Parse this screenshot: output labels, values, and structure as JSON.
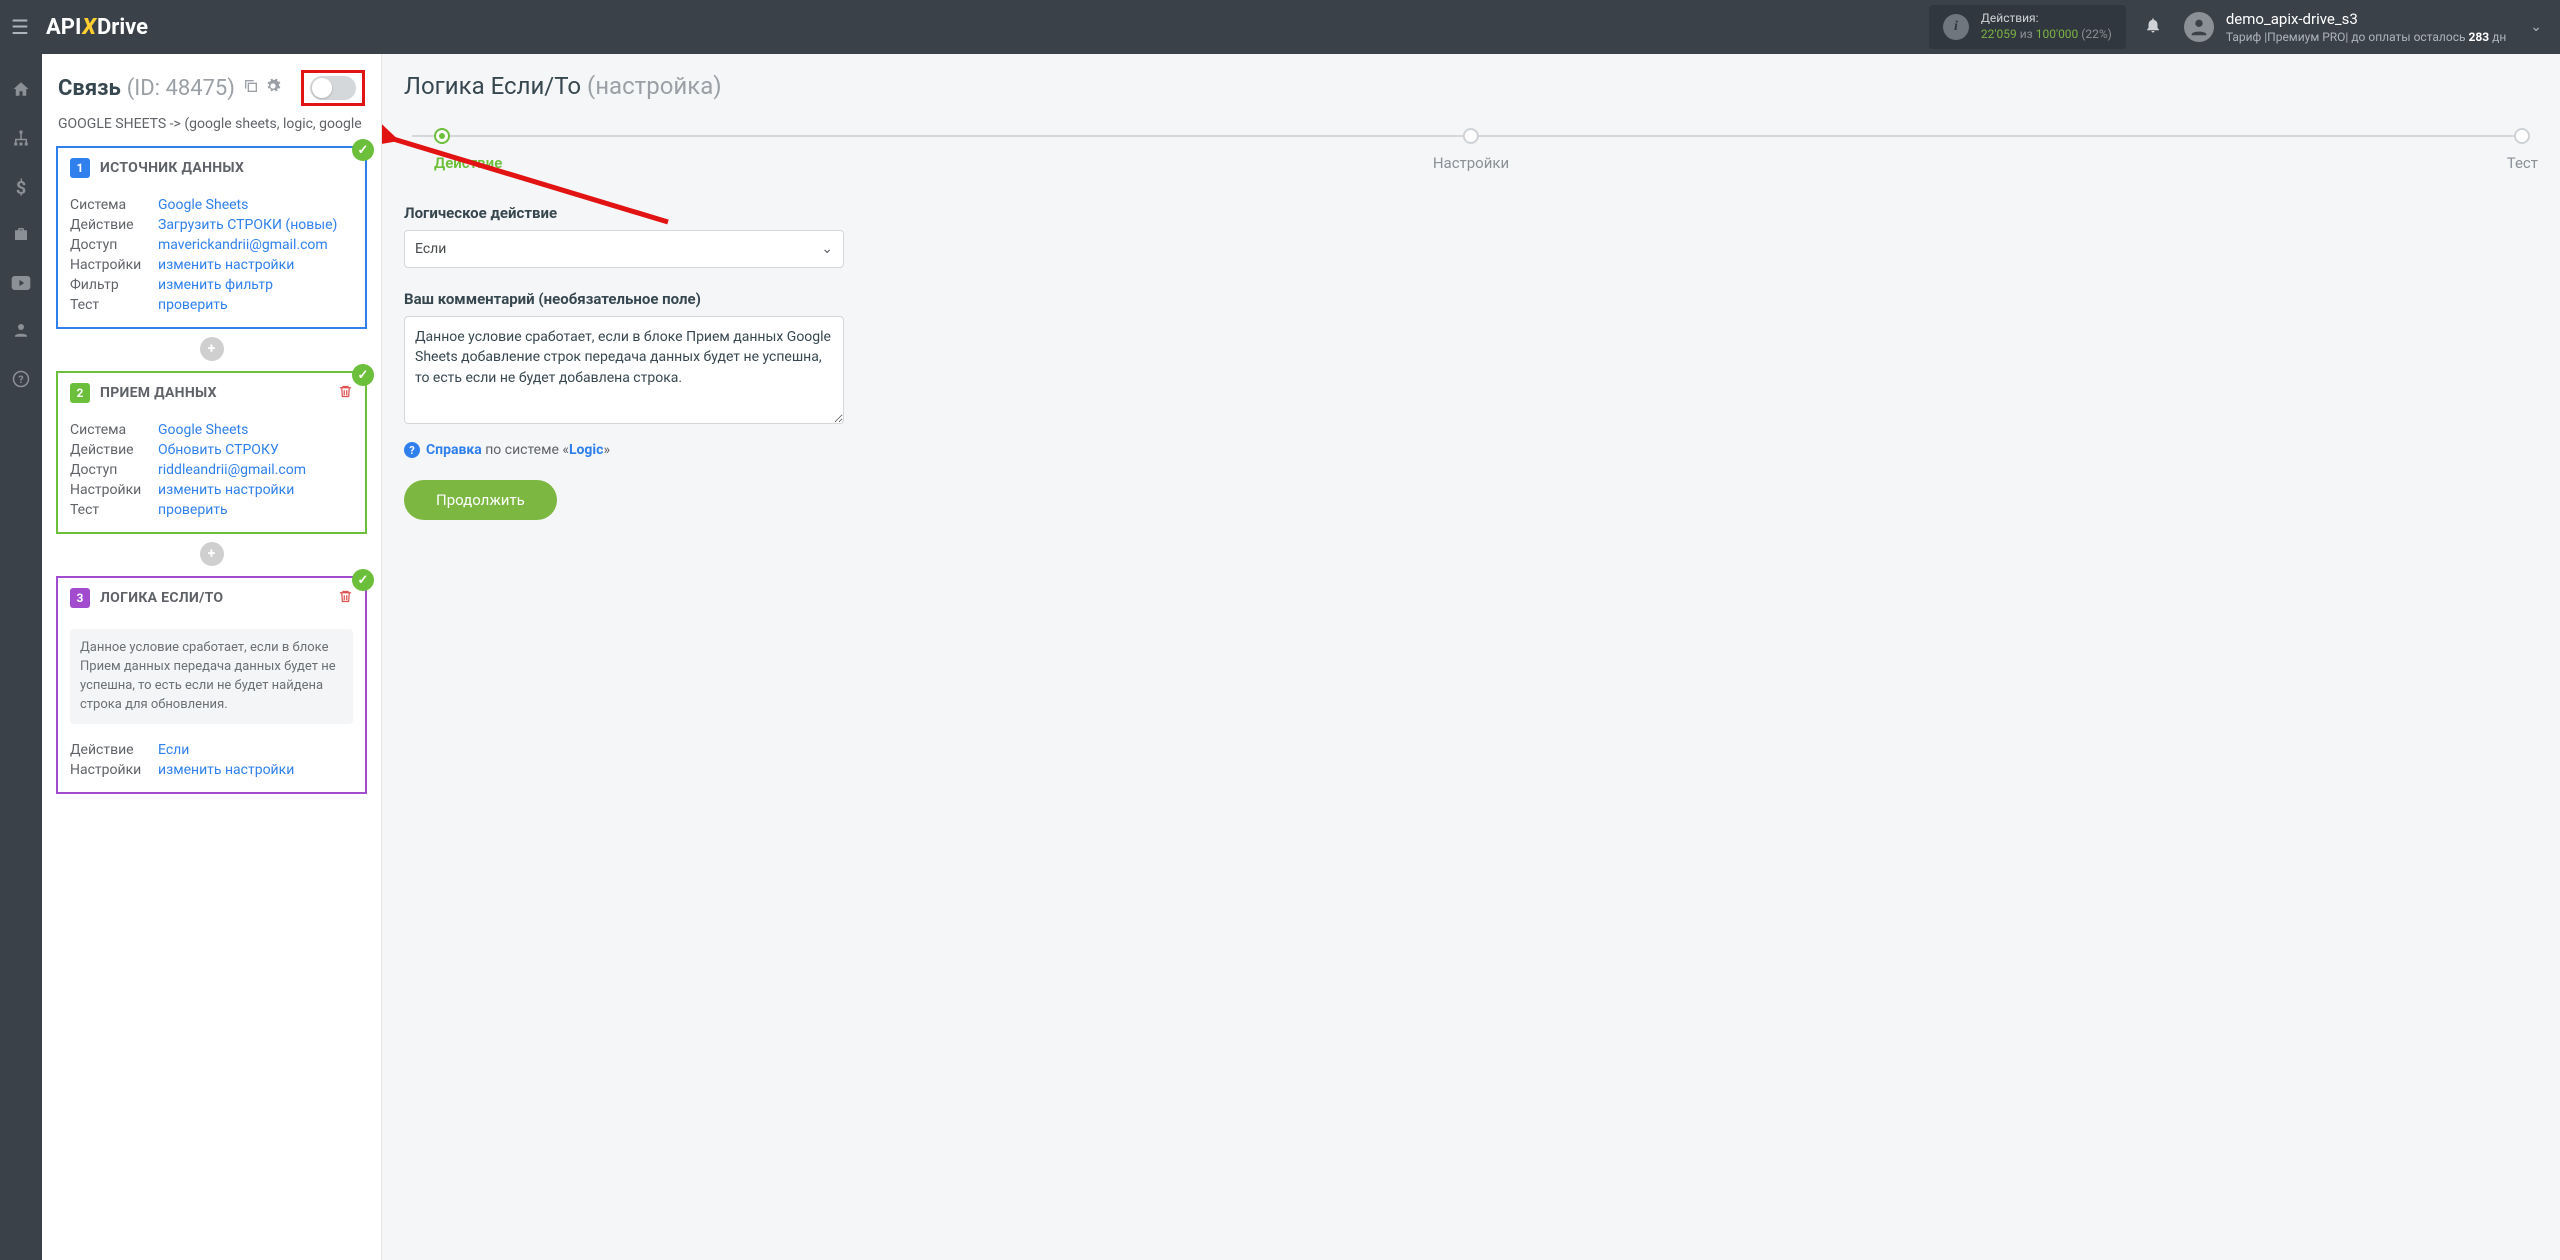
{
  "topbar": {
    "logo_pre": "API",
    "logo_x": "X",
    "logo_post": "Drive",
    "actions_label": "Действия:",
    "actions_used": "22'059",
    "actions_of": "из",
    "actions_total": "100'000",
    "actions_pct": "(22%)",
    "username": "demo_apix-drive_s3",
    "tariff_line_pre": "Тариф |Премиум PRO| до оплаты осталось ",
    "tariff_days": "283",
    "tariff_days_suffix": " дн"
  },
  "sidebar": {
    "title": "Связь",
    "id": "(ID: 48475)",
    "subtitle": "GOOGLE SHEETS -> (google sheets, logic, google",
    "card1": {
      "num": "1",
      "title": "ИСТОЧНИК ДАННЫХ",
      "rows": {
        "system_k": "Система",
        "system_v": "Google Sheets",
        "action_k": "Действие",
        "action_v": "Загрузить СТРОКИ (новые)",
        "access_k": "Доступ",
        "access_v": "maverickandrii@gmail.com",
        "settings_k": "Настройки",
        "settings_v": "изменить настройки",
        "filter_k": "Фильтр",
        "filter_v": "изменить фильтр",
        "test_k": "Тест",
        "test_v": "проверить"
      }
    },
    "card2": {
      "num": "2",
      "title": "ПРИЕМ ДАННЫХ",
      "rows": {
        "system_k": "Система",
        "system_v": "Google Sheets",
        "action_k": "Действие",
        "action_v": "Обновить СТРОКУ",
        "access_k": "Доступ",
        "access_v": "riddleandrii@gmail.com",
        "settings_k": "Настройки",
        "settings_v": "изменить настройки",
        "test_k": "Тест",
        "test_v": "проверить"
      }
    },
    "card3": {
      "num": "3",
      "title": "ЛОГИКА ЕСЛИ/ТО",
      "note": "Данное условие сработает, если в блоке Прием данных передача данных будет не успешна, то есть если не будет найдена строка для обновления.",
      "rows": {
        "action_k": "Действие",
        "action_v": "Если",
        "settings_k": "Настройки",
        "settings_v": "изменить настройки"
      }
    }
  },
  "main": {
    "title": "Логика Если/То",
    "title_grey": "(настройка)",
    "steps": {
      "s1": "Действие",
      "s2": "Настройки",
      "s3": "Тест"
    },
    "field1_label": "Логическое действие",
    "field1_value": "Если",
    "field2_label": "Ваш комментарий (необязательное поле)",
    "field2_value": "Данное условие сработает, если в блоке Прием данных Google Sheets добавление строк передача данных будет не успешна, то есть если не будет добавлена строка.",
    "help_bold": "Справка",
    "help_mid": " по системе «",
    "help_sys": "Logic",
    "help_end": "»",
    "continue": "Продолжить"
  }
}
